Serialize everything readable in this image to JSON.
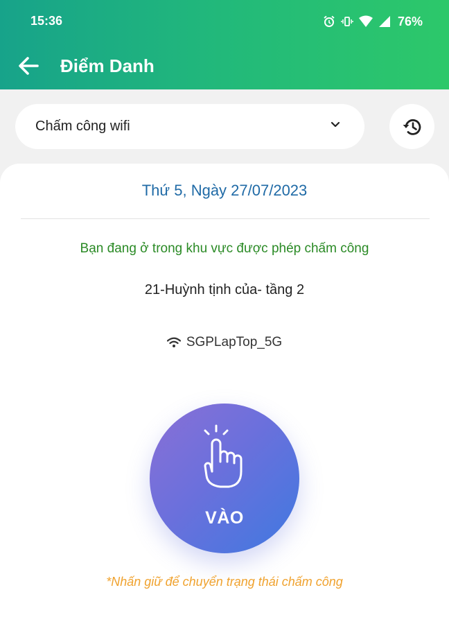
{
  "status_bar": {
    "time": "15:36",
    "battery": "76%",
    "icons": [
      "alarm-icon",
      "vibrate-icon",
      "wifi-icon",
      "signal-icon"
    ]
  },
  "header": {
    "title": "Điểm Danh",
    "background_colors": [
      "#17a38a",
      "#2dc86a"
    ]
  },
  "attendance_type": {
    "selected": "Chấm công wifi"
  },
  "card": {
    "date": "Thứ 5, Ngày 27/07/2023",
    "zone_status": "Bạn đang ở trong khu vực được phép chấm công",
    "location": "21-Huỳnh tịnh của- tầng 2",
    "wifi_name": "SGPLapTop_5G",
    "checkin_label": "VÀO",
    "hint": "*Nhấn giữ để chuyển trạng thái chấm công"
  },
  "colors": {
    "date": "#1f6aa6",
    "zone_status": "#2a8a25",
    "hint": "#f0a22e",
    "button_gradient": [
      "#8a6fd6",
      "#3f79e0"
    ]
  }
}
